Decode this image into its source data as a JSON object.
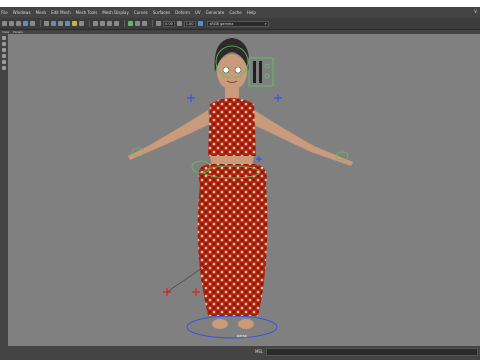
{
  "menubar": {
    "items": [
      "File",
      "Windows",
      "Mesh",
      "Edit Mesh",
      "Mesh Tools",
      "Mesh Display",
      "Curves",
      "Surfaces",
      "Deform",
      "UV",
      "Generate",
      "Cache",
      "Help"
    ],
    "window_control": "V"
  },
  "panel_menu": {
    "items": [
      "View",
      "Panels"
    ]
  },
  "toolbar": {
    "field_value_1": "0.00",
    "field_value_2": "1.00",
    "camera_field": "sRGB gamma"
  },
  "viewport": {
    "camera_label": "persp",
    "background_color": "#808080"
  },
  "statusbar": {
    "mel_label": "MEL"
  },
  "colors": {
    "dress_red": "#b0220f",
    "skin": "#c99a7c",
    "hair": "#2e2a2a",
    "controller_green": "#60c060",
    "controller_blue": "#3355dd",
    "controller_red": "#dd2222"
  }
}
